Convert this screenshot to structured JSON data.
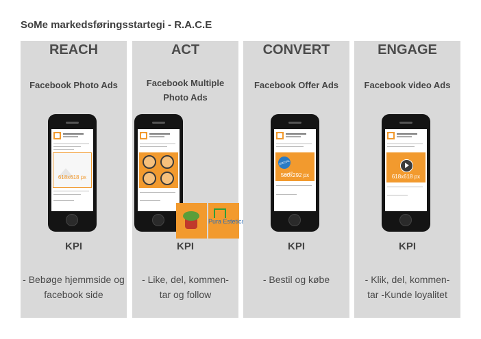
{
  "page_title": "SoMe markedsføringsstartegi  - R.A.C.E",
  "columns": [
    {
      "heading": "REACH",
      "ad_type": "Facebook Photo Ads",
      "media_label": "618x618 px",
      "kpi": "KPI",
      "description": "- Bebøge hjemmside og facebook side"
    },
    {
      "heading": "ACT",
      "ad_type": "Facebook Multiple Photo Ads",
      "media_label": "",
      "kpi": "KPI",
      "description": "- Like, del, kommen- tar og follow",
      "extra_tile_text": "Pura Estetica"
    },
    {
      "heading": "CONVERT",
      "ad_type": "Facebook Offer Ads",
      "media_label": "560x292 px",
      "kpi": "KPI",
      "description": "- Bestil og købe",
      "badge_text": "SPECIAL OFFER"
    },
    {
      "heading": "ENGAGE",
      "ad_type": "Facebook video Ads",
      "media_label": "618x618 px",
      "kpi": "KPI",
      "description": "- Klik, del, kommen- tar -Kunde loyalitet"
    }
  ],
  "colors": {
    "column_bg": "#d9d9d9",
    "accent": "#f29a2e",
    "phone": "#141414",
    "offer_badge": "#2b7bc4"
  }
}
